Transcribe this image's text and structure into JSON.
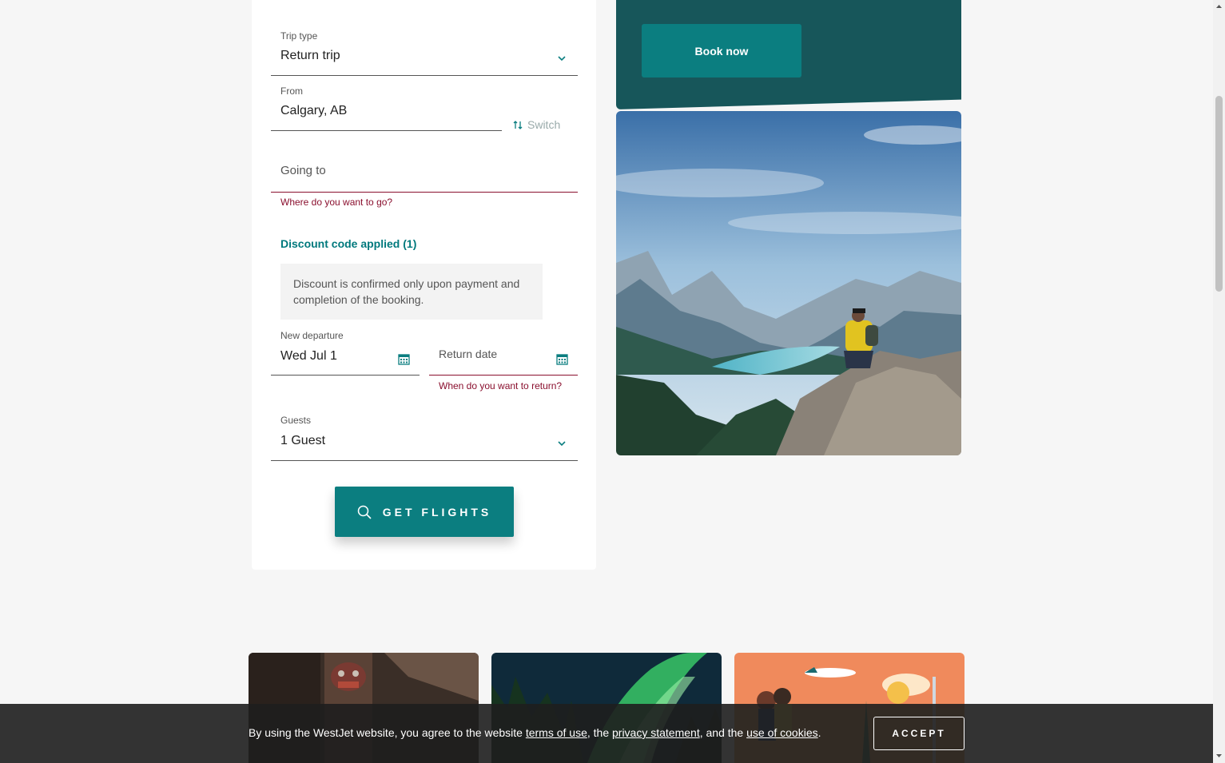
{
  "booking": {
    "trip_type": {
      "label": "Trip type",
      "value": "Return trip"
    },
    "from": {
      "label": "From",
      "value": "Calgary, AB"
    },
    "switch_label": "Switch",
    "going_to": {
      "placeholder": "Going to",
      "error": "Where do you want to go?"
    },
    "discount": {
      "title": "Discount code applied (1)",
      "note": "Discount is confirmed only upon payment and completion of the booking."
    },
    "departure": {
      "label": "New departure",
      "value": "Wed Jul 1"
    },
    "return_date": {
      "placeholder": "Return date",
      "error": "When do you want to return?"
    },
    "guests": {
      "label": "Guests",
      "value": "1 Guest"
    },
    "submit_label": "GET FLIGHTS"
  },
  "promo": {
    "button_label": "Book now"
  },
  "cookie_bar": {
    "text_before": "By using the WestJet website, you agree to the website ",
    "link_terms": "terms of use",
    "text_mid1": ", the ",
    "link_privacy": "privacy statement",
    "text_mid2": ", and the ",
    "link_cookies": "use of cookies",
    "text_end": ".",
    "accept_label": "ACCEPT"
  },
  "colors": {
    "accent": "#0b7e80",
    "promo_bg": "#17565a",
    "error": "#8a0f2e"
  }
}
